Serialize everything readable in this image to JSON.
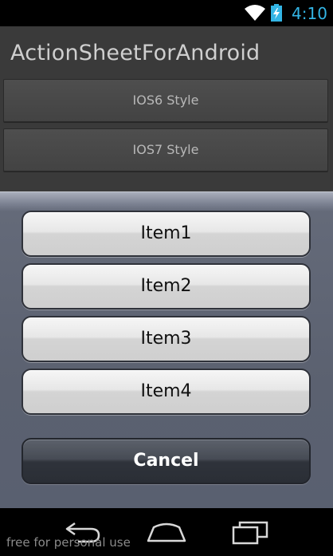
{
  "status_bar": {
    "time": "4:10",
    "accent_color": "#33b5e5",
    "icons": [
      "wifi-icon",
      "battery-charging-icon"
    ]
  },
  "app": {
    "title": "ActionSheetForAndroid",
    "buttons": [
      {
        "label": "IOS6 Style"
      },
      {
        "label": "IOS7 Style"
      }
    ]
  },
  "action_sheet": {
    "items": [
      {
        "label": "Item1"
      },
      {
        "label": "Item2"
      },
      {
        "label": "Item3"
      },
      {
        "label": "Item4"
      }
    ],
    "cancel_label": "Cancel"
  },
  "nav_bar": {
    "icons": [
      "back-icon",
      "home-icon",
      "recent-apps-icon"
    ],
    "watermark": "free for personal use"
  }
}
